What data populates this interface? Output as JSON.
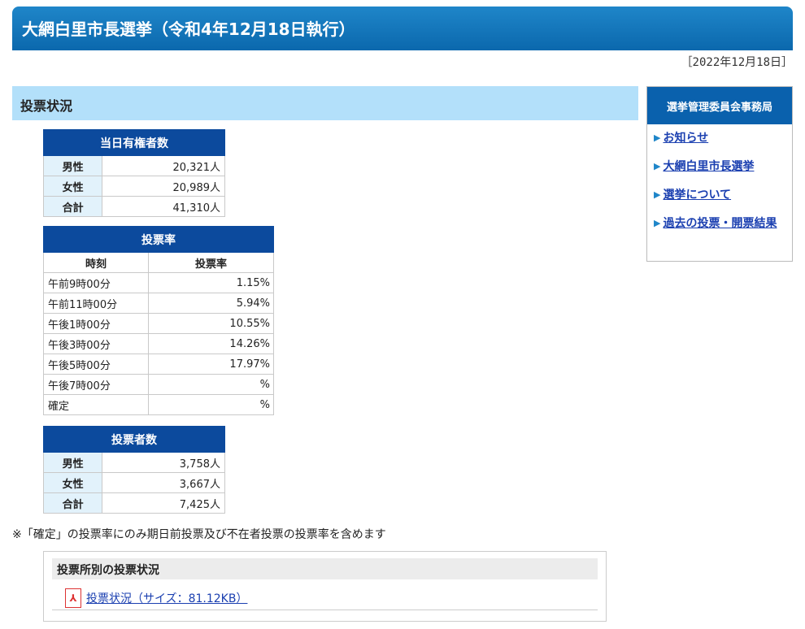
{
  "header": {
    "title": "大網白里市長選挙（令和4年12月18日執行）"
  },
  "date": "［2022年12月18日］",
  "main": {
    "heading": "投票状況"
  },
  "voters_table": {
    "caption": "当日有権者数",
    "rows": [
      {
        "label": "男性",
        "value": "20,321人"
      },
      {
        "label": "女性",
        "value": "20,989人"
      },
      {
        "label": "合計",
        "value": "41,310人"
      }
    ]
  },
  "rate_table": {
    "caption": "投票率",
    "col_time": "時刻",
    "col_rate": "投票率",
    "rows": [
      {
        "time": "午前9時00分",
        "rate": "1.15%"
      },
      {
        "time": "午前11時00分",
        "rate": "5.94%"
      },
      {
        "time": "午後1時00分",
        "rate": "10.55%"
      },
      {
        "time": "午後3時00分",
        "rate": "14.26%"
      },
      {
        "time": "午後5時00分",
        "rate": "17.97%"
      },
      {
        "time": "午後7時00分",
        "rate": "%"
      },
      {
        "time": "確定",
        "rate": "%"
      }
    ]
  },
  "turnout_table": {
    "caption": "投票者数",
    "rows": [
      {
        "label": "男性",
        "value": "3,758人"
      },
      {
        "label": "女性",
        "value": "3,667人"
      },
      {
        "label": "合計",
        "value": "7,425人"
      }
    ]
  },
  "note": "※「確定」の投票率にのみ期日前投票及び不在者投票の投票率を含めます",
  "box": {
    "title": "投票所別の投票状況",
    "link_label": "投票状況（サイズ：81.12KB）",
    "icon": "pdf-icon"
  },
  "sidebar": {
    "title": "選挙管理委員会事務局",
    "items": [
      {
        "label": "お知らせ"
      },
      {
        "label": "大網白里市長選挙"
      },
      {
        "label": "選挙について"
      },
      {
        "label": "過去の投票・開票結果"
      }
    ]
  }
}
